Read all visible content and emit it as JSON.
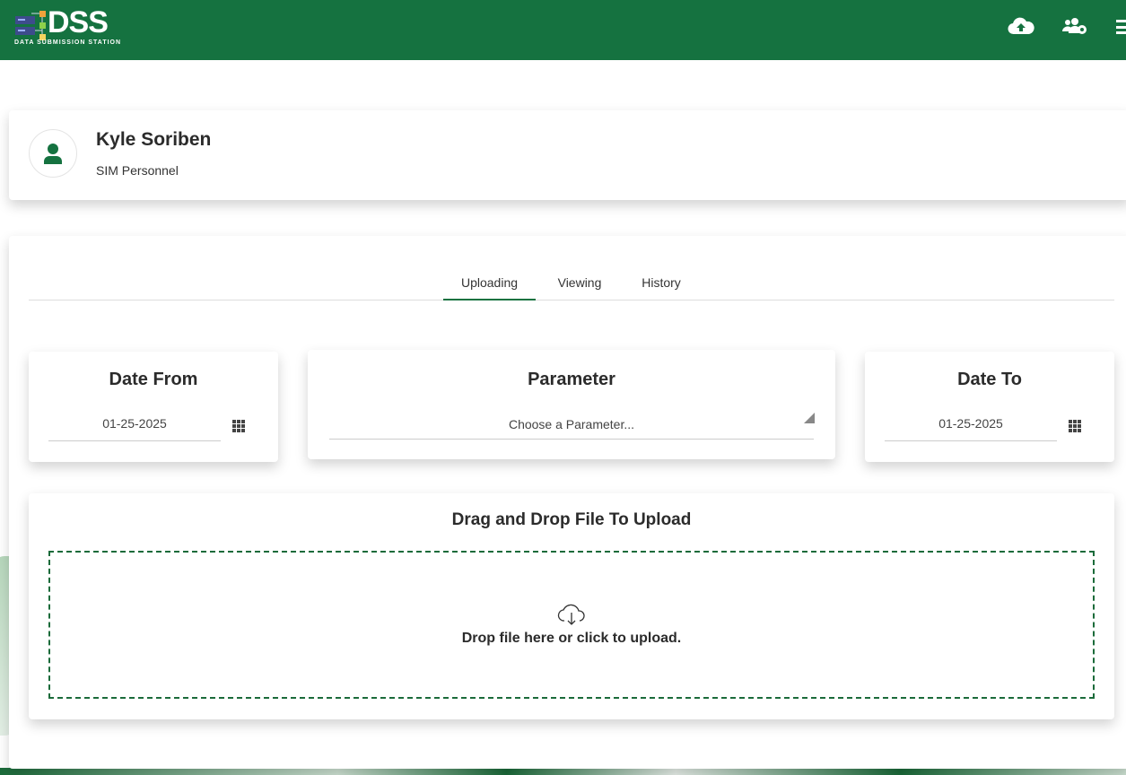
{
  "header": {
    "logo_text": "DSS",
    "logo_subtitle": "DATA SUBMISSION STATION",
    "icons": [
      "cloud-upload-icon",
      "users-cog-icon",
      "menu-icon"
    ],
    "color": "#157240"
  },
  "profile": {
    "name": "Kyle Soriben",
    "role": "SIM Personnel",
    "icon": "user-icon"
  },
  "tabs": [
    {
      "label": "Uploading",
      "active": true
    },
    {
      "label": "Viewing"
    },
    {
      "label": "History"
    }
  ],
  "filters": {
    "date_from": {
      "title": "Date From",
      "value": "01-25-2025",
      "icon": "calendar-grid-icon"
    },
    "parameter": {
      "title": "Parameter",
      "placeholder": "Choose a Parameter..."
    },
    "date_to": {
      "title": "Date To",
      "value": "01-25-2025",
      "icon": "calendar-grid-icon"
    }
  },
  "upload": {
    "title": "Drag and Drop File To Upload",
    "drop_text": "Drop file here or click to upload.",
    "icon": "cloud-download-icon"
  }
}
